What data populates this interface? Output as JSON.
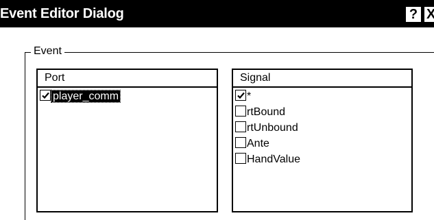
{
  "window": {
    "title": "Event Editor Dialog",
    "help_label": "?",
    "close_label": "X"
  },
  "event_group": {
    "label": "Event"
  },
  "port_list": {
    "header": "Port",
    "items": [
      {
        "label": "player_comm",
        "checked": true,
        "selected": true
      }
    ]
  },
  "signal_list": {
    "header": "Signal",
    "items": [
      {
        "label": "*",
        "checked": true
      },
      {
        "label": "rtBound",
        "checked": false
      },
      {
        "label": "rtUnbound",
        "checked": false
      },
      {
        "label": "Ante",
        "checked": false
      },
      {
        "label": "HandValue",
        "checked": false
      }
    ]
  },
  "colors": {
    "titlebar": "#000000",
    "title_text": "#ffffff",
    "background": "#ffffff",
    "selection": "#000000"
  },
  "icons": {
    "checkmark": "checkmark-icon",
    "help": "question-icon",
    "close": "close-icon"
  }
}
